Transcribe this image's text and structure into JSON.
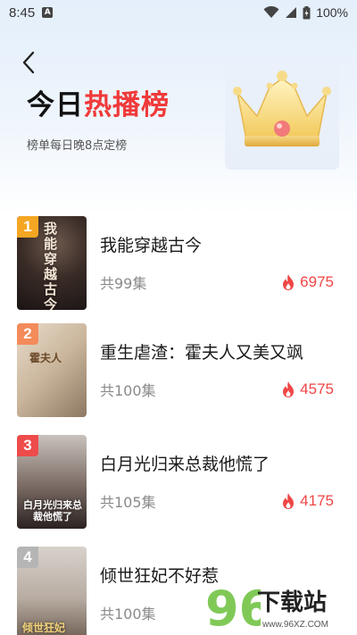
{
  "status_bar": {
    "time": "8:45",
    "notification_letter": "A",
    "battery": "100%"
  },
  "header": {
    "title_part1": "今日",
    "title_part2": "热播榜",
    "subtitle": "榜单每日晚8点定榜"
  },
  "colors": {
    "accent_red": "#f03a3a",
    "heat_red": "#f04646",
    "rank_1": "#f5a623",
    "rank_2": "#f38b5a",
    "rank_3": "#ee4b4b",
    "rank_4": "#b5b5b5"
  },
  "dramas": [
    {
      "rank": "1",
      "title": "我能穿越古今",
      "episodes": "共99集",
      "heat": "6975",
      "cover_text": "我能穿越古今"
    },
    {
      "rank": "2",
      "title": "重生虐渣：霍夫人又美又飒",
      "episodes": "共100集",
      "heat": "4575",
      "cover_text": "霍夫人"
    },
    {
      "rank": "3",
      "title": "白月光归来总裁他慌了",
      "episodes": "共105集",
      "heat": "4175",
      "cover_text": "白月光归来总裁他慌了"
    },
    {
      "rank": "4",
      "title": "倾世狂妃不好惹",
      "episodes": "共100集",
      "heat": "",
      "cover_text": "倾世狂妃"
    }
  ],
  "watermark": {
    "logo_digits": "96",
    "text": "下载站",
    "url": "www.96XZ.COM"
  }
}
